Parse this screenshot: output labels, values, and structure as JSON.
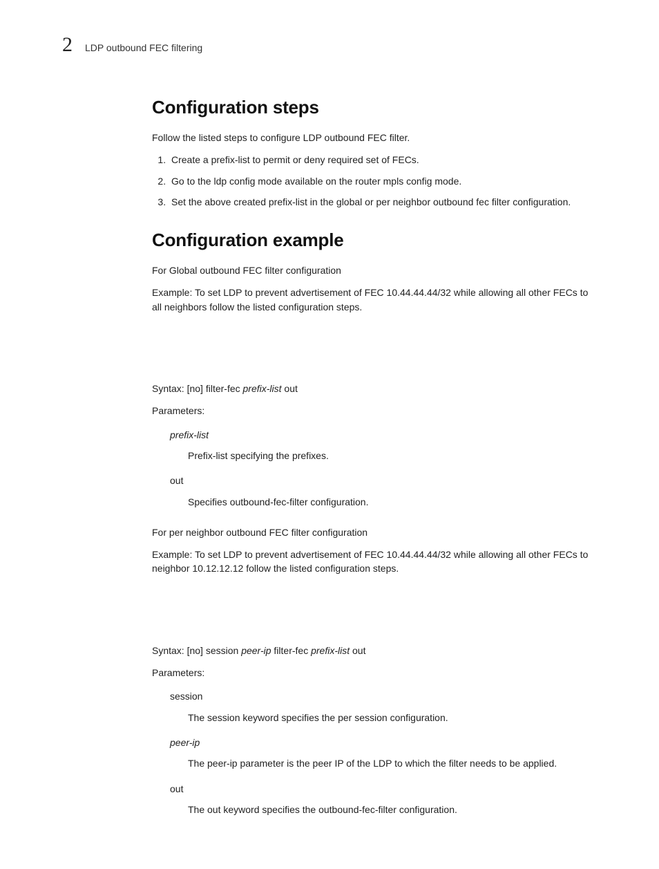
{
  "header": {
    "chapter_number": "2",
    "running_title": "LDP outbound FEC filtering"
  },
  "section_steps": {
    "heading": "Configuration steps",
    "intro": "Follow the listed steps to configure LDP outbound FEC filter.",
    "items": [
      "Create a prefix-list to permit or deny required set of FECs.",
      "Go to the ldp config mode available on the router mpls config mode.",
      "Set the above created prefix-list in the global or per neighbor outbound fec filter configuration."
    ]
  },
  "section_example": {
    "heading": "Configuration example",
    "global": {
      "title": "For Global outbound FEC filter configuration",
      "example": "Example: To set LDP to prevent advertisement of FEC 10.44.44.44/32 while allowing all other FECs to all neighbors follow the listed configuration steps.",
      "syntax_label": "Syntax:",
      "syntax_pre": " [no] filter-fec ",
      "syntax_var": "prefix-list",
      "syntax_post": " out",
      "params_label": "Parameters:",
      "params": [
        {
          "term": "prefix-list",
          "term_italic": true,
          "desc": "Prefix-list specifying the prefixes."
        },
        {
          "term": "out",
          "term_italic": false,
          "desc": "Specifies outbound-fec-filter configuration."
        }
      ]
    },
    "neighbor": {
      "title": "For per neighbor outbound FEC filter configuration",
      "example": "Example: To set LDP to prevent advertisement of FEC 10.44.44.44/32 while allowing all other FECs to neighbor 10.12.12.12 follow the listed configuration steps.",
      "syntax_label": "Syntax:",
      "syntax_a": " [no] session ",
      "syntax_var1": "peer-ip",
      "syntax_b": " filter-fec ",
      "syntax_var2": "prefix-list",
      "syntax_c": " out",
      "params_label": "Parameters:",
      "params": [
        {
          "term": "session",
          "term_italic": false,
          "desc": "The session keyword specifies the per session configuration."
        },
        {
          "term": "peer-ip",
          "term_italic": true,
          "desc": "The peer-ip parameter is the peer IP of the LDP to which the filter needs to be applied."
        },
        {
          "term": "out",
          "term_italic": false,
          "desc": "The out keyword specifies the outbound-fec-filter configuration."
        }
      ]
    }
  }
}
